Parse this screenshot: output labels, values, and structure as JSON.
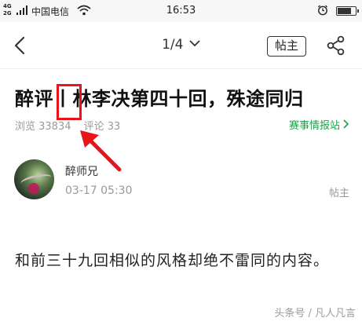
{
  "status_bar": {
    "network_label_top": "4G",
    "network_label_bottom": "2G",
    "carrier": "中国电信",
    "time": "16:53",
    "battery_level": 0.85
  },
  "nav": {
    "pager": "1/4",
    "op_label": "帖主"
  },
  "article": {
    "title": "醉评丨林李决第四十回，殊途同归",
    "views": "浏览 33834",
    "comments": "评论 33",
    "source": "赛事情报站"
  },
  "author": {
    "name": "醉师兄",
    "time": "03-17 05:30",
    "tag": "帖主"
  },
  "content": {
    "paragraph": "和前三十九回相似的风格却绝不雷同的内容。"
  },
  "watermark": "头条号 / 凡人凡言",
  "colors": {
    "accent_green": "#17a44a",
    "annotation_red": "#e8141a"
  }
}
